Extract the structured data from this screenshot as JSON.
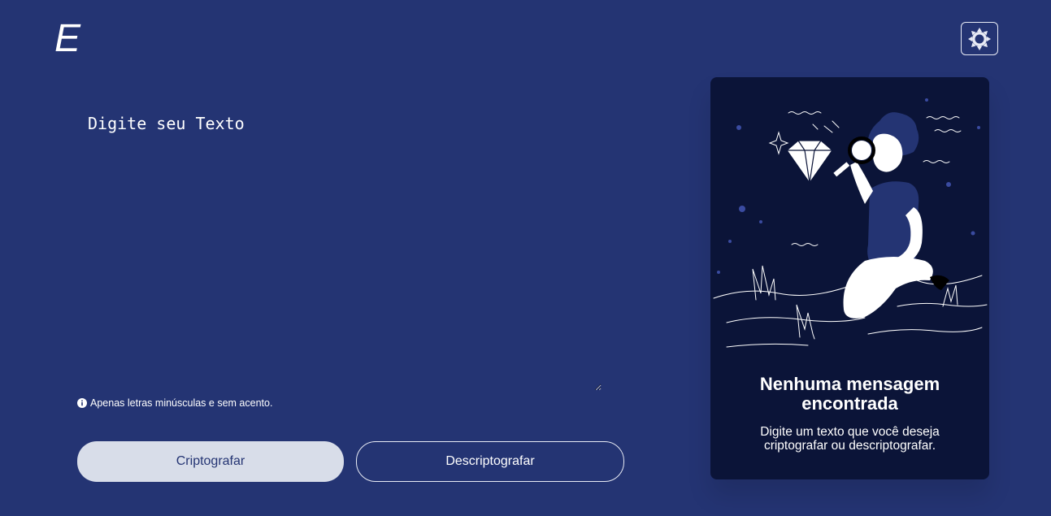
{
  "header": {
    "logo_text": "E",
    "theme_toggle_icon": "sun-gear-icon"
  },
  "input": {
    "placeholder": "Digite seu Texto",
    "value": ""
  },
  "hint": {
    "icon": "info-icon",
    "text": "Apenas letras minúsculas e sem acento."
  },
  "actions": {
    "encrypt_label": "Criptografar",
    "decrypt_label": "Descriptografar"
  },
  "output_panel": {
    "illustration": "person-with-magnifier-illustration",
    "title": "Nenhuma mensagem encontrada",
    "subtitle": "Digite um texto que você deseja criptografar ou descriptografar."
  },
  "colors": {
    "background": "#243473",
    "panel": "#0b1438",
    "button_primary": "#d8dde9",
    "text": "#ffffff"
  }
}
